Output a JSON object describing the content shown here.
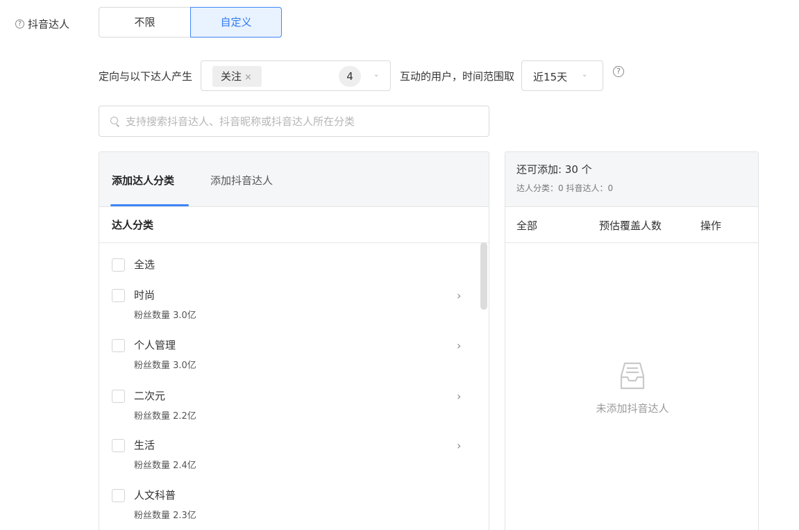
{
  "field": {
    "help": "?",
    "label": "抖音达人"
  },
  "mode": {
    "options": [
      "不限",
      "自定义"
    ],
    "selected": "自定义"
  },
  "targeting": {
    "prefix": "定向与以下达人产生",
    "tag": "关注",
    "tag_close": "×",
    "count": "4",
    "middle": "互动的用户，时间范围取",
    "range": "近15天",
    "help": "?"
  },
  "search": {
    "placeholder": "支持搜索抖音达人、抖音昵称或抖音达人所在分类"
  },
  "left_panel": {
    "tabs": [
      "添加达人分类",
      "添加抖音达人"
    ],
    "active_tab": "添加达人分类",
    "column": "达人分类",
    "select_all": "全选",
    "items": [
      {
        "name": "时尚",
        "fans": "粉丝数量 3.0亿",
        "arrow": "›"
      },
      {
        "name": "个人管理",
        "fans": "粉丝数量 3.0亿",
        "arrow": "›"
      },
      {
        "name": "二次元",
        "fans": "粉丝数量 2.2亿",
        "arrow": "›"
      },
      {
        "name": "生活",
        "fans": "粉丝数量 2.4亿",
        "arrow": "›"
      },
      {
        "name": "人文科普",
        "fans": "粉丝数量 2.3亿",
        "arrow": ""
      }
    ]
  },
  "right_panel": {
    "remaining": "还可添加:  30 个",
    "summary": "达人分类：0 抖音达人：0",
    "columns": [
      "全部",
      "预估覆盖人数",
      "操作"
    ],
    "empty_text": "未添加抖音达人"
  },
  "colors": {
    "accent": "#3e86f6",
    "active_bg": "#e9f2ff",
    "panel_bg": "#f5f6f8"
  },
  "icons": [
    "help-circle-icon",
    "chevron-down-icon",
    "search-icon",
    "chevron-right-icon",
    "empty-inbox-icon"
  ]
}
